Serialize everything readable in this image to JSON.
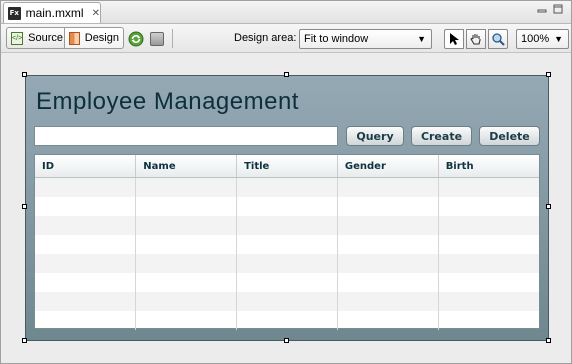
{
  "tab": {
    "label": "main.mxml",
    "icon": "flex-file-icon",
    "close": "✕"
  },
  "window_controls": {
    "minimize": "▭",
    "maximize": "◻"
  },
  "toolbar": {
    "source_label": "Source",
    "design_label": "Design",
    "design_area_label": "Design area:",
    "design_area_value": "Fit to window",
    "zoom_value": "100%",
    "icons": [
      "source-icon",
      "design-icon",
      "refresh-icon",
      "layout-grid-icon",
      "select-arrow-icon",
      "hand-icon",
      "magnify-icon"
    ]
  },
  "app": {
    "title": "Employee Management",
    "search_value": "",
    "buttons": {
      "query": "Query",
      "create": "Create",
      "delete": "Delete"
    },
    "columns": [
      "ID",
      "Name",
      "Title",
      "Gender",
      "Birth"
    ],
    "empty_rows": 8
  },
  "colors": {
    "panel_top": "#95a9b4",
    "panel_bottom": "#6f878f",
    "title": "#0d2f3b"
  }
}
